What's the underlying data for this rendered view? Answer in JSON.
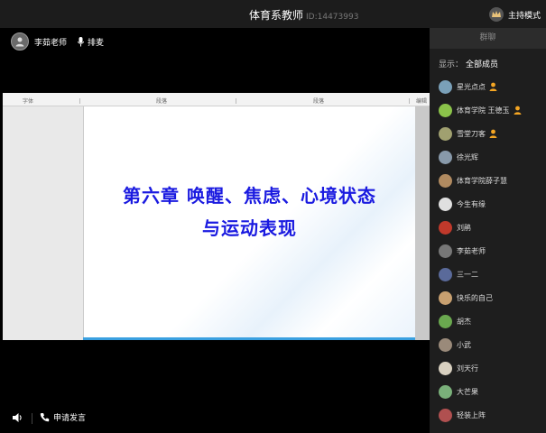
{
  "titlebar": {
    "title": "体育系教师",
    "id_text": "ID:14473993",
    "host_mode": "主持模式"
  },
  "presenter": {
    "name": "李茹老师",
    "mic_label": "排麦"
  },
  "ruler": {
    "labels": [
      "字体",
      "段落",
      "段落",
      "编辑"
    ]
  },
  "slide": {
    "line1": "第六章 唤醒、焦虑、心境状态",
    "line2": "与运动表现"
  },
  "bottombar": {
    "apply_label": "申请发言"
  },
  "panel": {
    "tab": "群聊",
    "filter_label": "显示：",
    "filter_value": "全部成员",
    "members": [
      {
        "name": "星光点点",
        "badge": true,
        "color": "#7aa0b8"
      },
      {
        "name": "体育学院 王德玉",
        "badge": true,
        "color": "#8bc34a"
      },
      {
        "name": "雪堂刀客",
        "badge": true,
        "color": "#a0a070"
      },
      {
        "name": "徐光辉",
        "badge": false,
        "color": "#8899aa"
      },
      {
        "name": "体育学院薛子慧",
        "badge": false,
        "color": "#b08a60"
      },
      {
        "name": "今生有缘",
        "badge": false,
        "color": "#e0e0e0"
      },
      {
        "name": "刘鹃",
        "badge": false,
        "color": "#c0392b"
      },
      {
        "name": "李茹老师",
        "badge": false,
        "color": "#777777"
      },
      {
        "name": "三一二",
        "badge": false,
        "color": "#5a6a9a"
      },
      {
        "name": "快乐的自己",
        "badge": false,
        "color": "#c8a070"
      },
      {
        "name": "胡杰",
        "badge": false,
        "color": "#6aa84f"
      },
      {
        "name": "小武",
        "badge": false,
        "color": "#9a8a7a"
      },
      {
        "name": "刘天行",
        "badge": false,
        "color": "#d8d0c0"
      },
      {
        "name": "大芒果",
        "badge": false,
        "color": "#7ab07a"
      },
      {
        "name": "轻装上阵",
        "badge": false,
        "color": "#b05050"
      }
    ]
  }
}
